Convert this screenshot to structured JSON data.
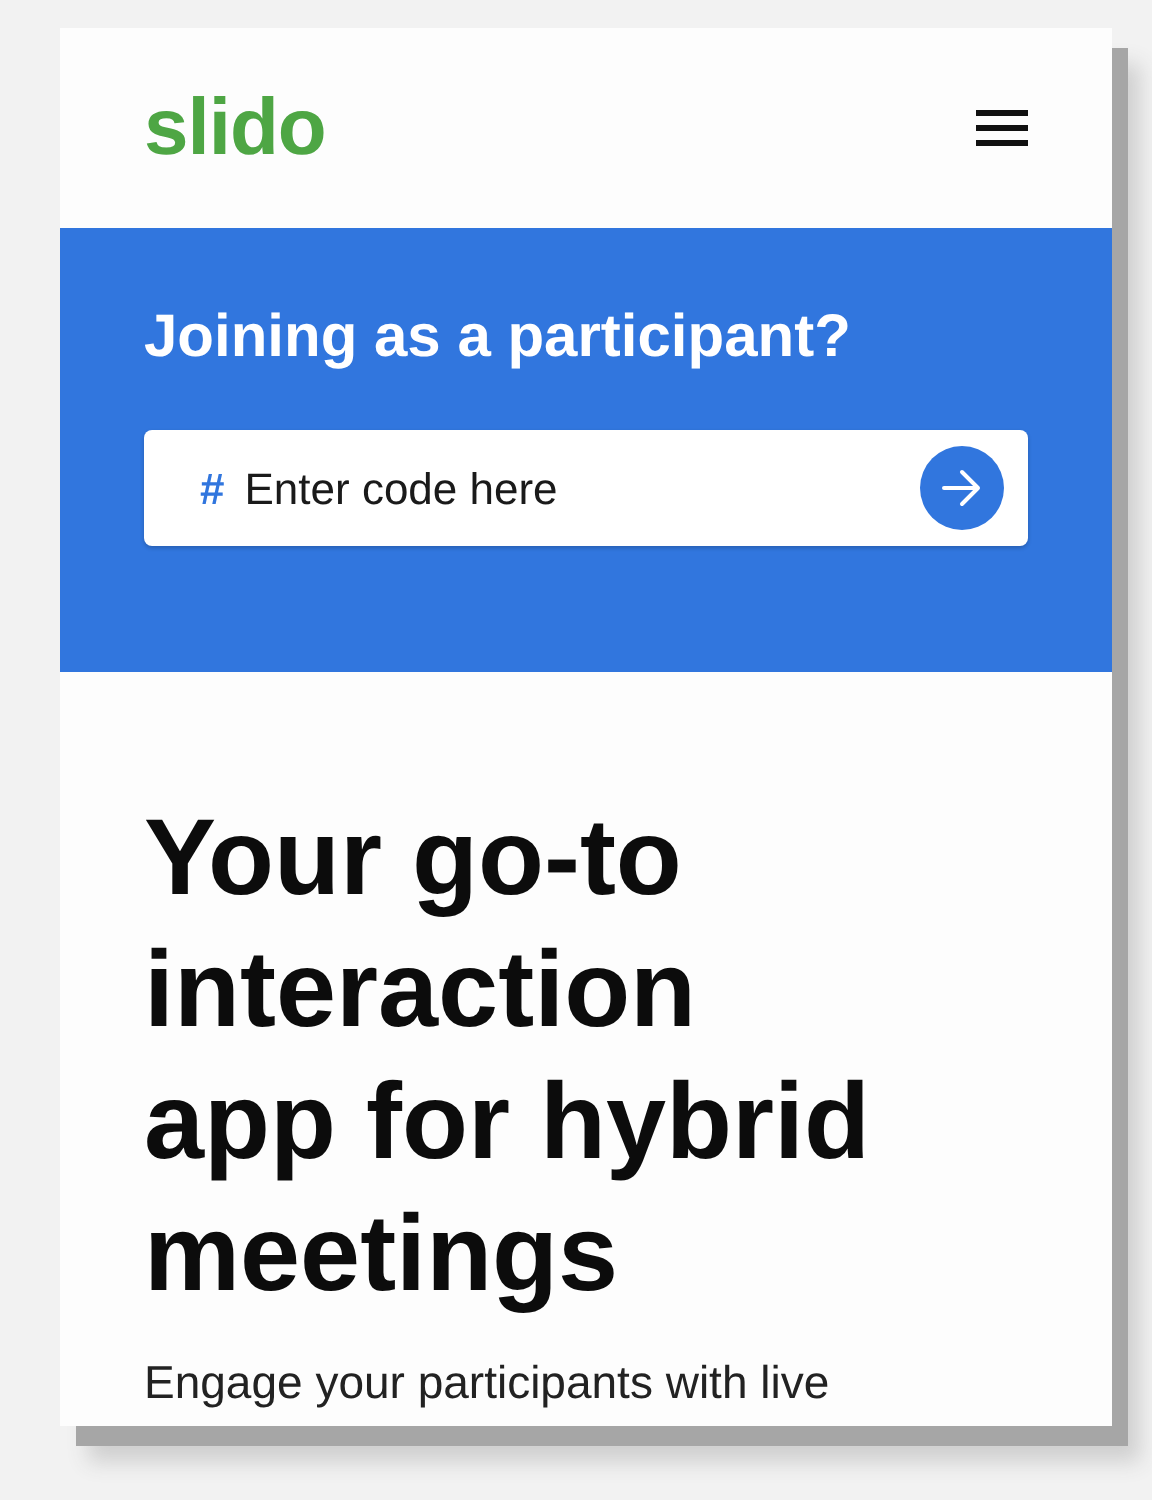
{
  "header": {
    "logo": "slido"
  },
  "join": {
    "title": "Joining as a participant?",
    "prefix": "#",
    "placeholder": "Enter code here"
  },
  "hero": {
    "headline_lines": [
      "Your go-to",
      "interaction",
      "app for hybrid",
      "meetings"
    ],
    "intro": "Engage your participants with live"
  }
}
